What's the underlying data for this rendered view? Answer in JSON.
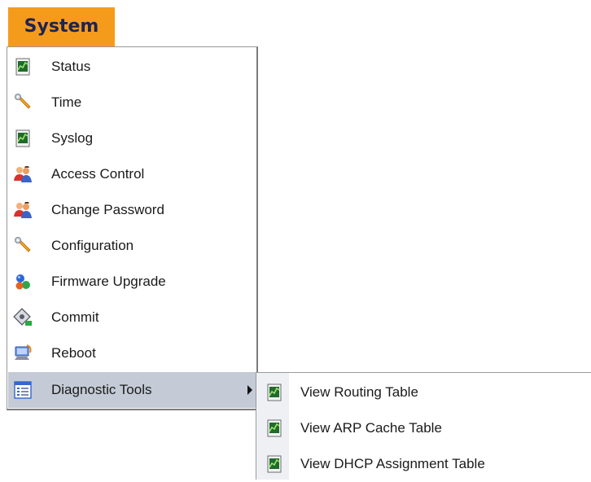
{
  "tab": {
    "label": "System"
  },
  "menu": {
    "items": [
      {
        "label": "Status",
        "icon": "chart-document-icon"
      },
      {
        "label": "Time",
        "icon": "wrench-icon"
      },
      {
        "label": "Syslog",
        "icon": "chart-document-icon"
      },
      {
        "label": "Access Control",
        "icon": "users-icon"
      },
      {
        "label": "Change Password",
        "icon": "users-icon"
      },
      {
        "label": "Configuration",
        "icon": "wrench-icon"
      },
      {
        "label": "Firmware Upgrade",
        "icon": "molecule-icon"
      },
      {
        "label": "Commit",
        "icon": "disk-commit-icon"
      },
      {
        "label": "Reboot",
        "icon": "computer-icon"
      },
      {
        "label": "Diagnostic Tools",
        "icon": "list-window-icon"
      }
    ]
  },
  "submenu": {
    "items": [
      {
        "label": "View Routing Table",
        "icon": "chart-document-icon"
      },
      {
        "label": "View ARP Cache Table",
        "icon": "chart-document-icon"
      },
      {
        "label": "View DHCP Assignment Table",
        "icon": "chart-document-icon"
      }
    ]
  },
  "colors": {
    "tab_background": "#f59b1c",
    "tab_text": "#1e2450",
    "active_item_background": "#c4cbd6"
  }
}
